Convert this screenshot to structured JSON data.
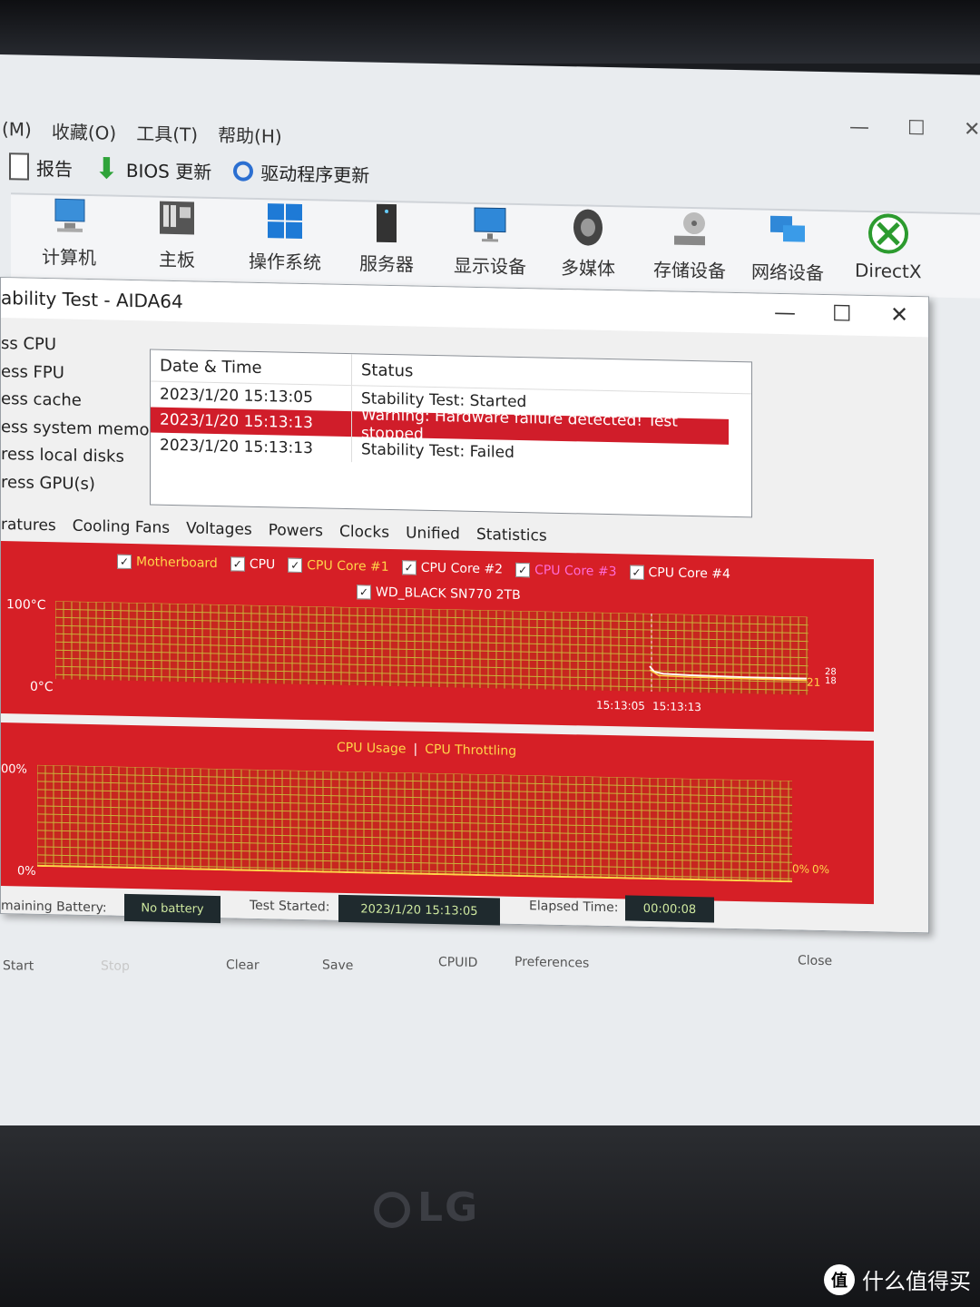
{
  "menu": {
    "items": [
      "(M)",
      "收藏(O)",
      "工具(T)",
      "帮助(H)"
    ]
  },
  "window_controls": {
    "minimize": "—",
    "maximize": "☐",
    "close": "✕"
  },
  "toolbar": {
    "report": "报告",
    "bios": "BIOS 更新",
    "driver": "驱动程序更新"
  },
  "categories": [
    "计算机",
    "主板",
    "操作系统",
    "服务器",
    "显示设备",
    "多媒体",
    "存储设备",
    "网络设备",
    "DirectX"
  ],
  "stability_window": {
    "title": "ability Test - AIDA64",
    "options": [
      "ss CPU",
      "ess FPU",
      "ess cache",
      "ess system memory",
      "ress local disks",
      "ress GPU(s)"
    ],
    "log": {
      "headers": [
        "Date & Time",
        "Status"
      ],
      "rows": [
        {
          "time": "2023/1/20 15:13:05",
          "status": "Stability Test: Started",
          "warn": false
        },
        {
          "time": "2023/1/20 15:13:13",
          "status": "Warning: Hardware failure detected! Test stopped",
          "warn": true
        },
        {
          "time": "2023/1/20 15:13:13",
          "status": "Stability Test: Failed",
          "warn": false
        }
      ]
    },
    "tabs": [
      "ratures",
      "Cooling Fans",
      "Voltages",
      "Powers",
      "Clocks",
      "Unified",
      "Statistics"
    ],
    "temp_chart": {
      "legend": [
        "Motherboard",
        "CPU",
        "CPU Core #1",
        "CPU Core #2",
        "CPU Core #3",
        "CPU Core #4",
        "WD_BLACK SN770 2TB"
      ],
      "legend_colors": [
        "#ffd54a",
        "#ffffff",
        "#ffd54a",
        "#ffffff",
        "#ff6bd6",
        "#ffffff",
        "#ffffff"
      ],
      "y_top": "100°C",
      "y_bottom": "0°C",
      "x_labels": [
        "15:13:05",
        "15:13:13"
      ],
      "right_values": [
        "21",
        "28",
        "18"
      ]
    },
    "usage_chart": {
      "legend": [
        "CPU Usage",
        "CPU Throttling"
      ],
      "separator": "|",
      "y_top": "00%",
      "y_bottom": "0%",
      "right_values": [
        "0%",
        "0%"
      ]
    },
    "status": {
      "battery_label": "maining Battery:",
      "battery_value": "No battery",
      "started_label": "Test Started:",
      "started_value": "2023/1/20 15:13:05",
      "elapsed_label": "Elapsed Time:",
      "elapsed_value": "00:00:08"
    },
    "buttons": [
      "Start",
      "Stop",
      "Clear",
      "Save",
      "CPUID",
      "Preferences",
      "Close"
    ]
  },
  "monitor": {
    "brand": "LG"
  },
  "watermark": {
    "icon": "值",
    "text": "什么值得买"
  }
}
